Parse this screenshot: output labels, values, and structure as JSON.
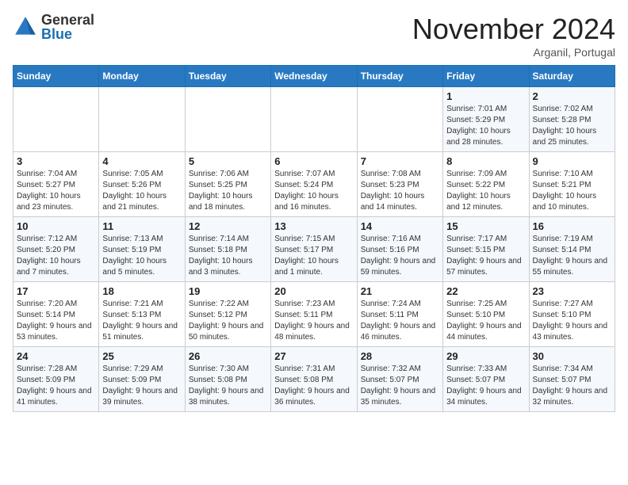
{
  "logo": {
    "general": "General",
    "blue": "Blue"
  },
  "header": {
    "month": "November 2024",
    "location": "Arganil, Portugal"
  },
  "weekdays": [
    "Sunday",
    "Monday",
    "Tuesday",
    "Wednesday",
    "Thursday",
    "Friday",
    "Saturday"
  ],
  "weeks": [
    [
      {
        "day": "",
        "info": ""
      },
      {
        "day": "",
        "info": ""
      },
      {
        "day": "",
        "info": ""
      },
      {
        "day": "",
        "info": ""
      },
      {
        "day": "",
        "info": ""
      },
      {
        "day": "1",
        "info": "Sunrise: 7:01 AM\nSunset: 5:29 PM\nDaylight: 10 hours and 28 minutes."
      },
      {
        "day": "2",
        "info": "Sunrise: 7:02 AM\nSunset: 5:28 PM\nDaylight: 10 hours and 25 minutes."
      }
    ],
    [
      {
        "day": "3",
        "info": "Sunrise: 7:04 AM\nSunset: 5:27 PM\nDaylight: 10 hours and 23 minutes."
      },
      {
        "day": "4",
        "info": "Sunrise: 7:05 AM\nSunset: 5:26 PM\nDaylight: 10 hours and 21 minutes."
      },
      {
        "day": "5",
        "info": "Sunrise: 7:06 AM\nSunset: 5:25 PM\nDaylight: 10 hours and 18 minutes."
      },
      {
        "day": "6",
        "info": "Sunrise: 7:07 AM\nSunset: 5:24 PM\nDaylight: 10 hours and 16 minutes."
      },
      {
        "day": "7",
        "info": "Sunrise: 7:08 AM\nSunset: 5:23 PM\nDaylight: 10 hours and 14 minutes."
      },
      {
        "day": "8",
        "info": "Sunrise: 7:09 AM\nSunset: 5:22 PM\nDaylight: 10 hours and 12 minutes."
      },
      {
        "day": "9",
        "info": "Sunrise: 7:10 AM\nSunset: 5:21 PM\nDaylight: 10 hours and 10 minutes."
      }
    ],
    [
      {
        "day": "10",
        "info": "Sunrise: 7:12 AM\nSunset: 5:20 PM\nDaylight: 10 hours and 7 minutes."
      },
      {
        "day": "11",
        "info": "Sunrise: 7:13 AM\nSunset: 5:19 PM\nDaylight: 10 hours and 5 minutes."
      },
      {
        "day": "12",
        "info": "Sunrise: 7:14 AM\nSunset: 5:18 PM\nDaylight: 10 hours and 3 minutes."
      },
      {
        "day": "13",
        "info": "Sunrise: 7:15 AM\nSunset: 5:17 PM\nDaylight: 10 hours and 1 minute."
      },
      {
        "day": "14",
        "info": "Sunrise: 7:16 AM\nSunset: 5:16 PM\nDaylight: 9 hours and 59 minutes."
      },
      {
        "day": "15",
        "info": "Sunrise: 7:17 AM\nSunset: 5:15 PM\nDaylight: 9 hours and 57 minutes."
      },
      {
        "day": "16",
        "info": "Sunrise: 7:19 AM\nSunset: 5:14 PM\nDaylight: 9 hours and 55 minutes."
      }
    ],
    [
      {
        "day": "17",
        "info": "Sunrise: 7:20 AM\nSunset: 5:14 PM\nDaylight: 9 hours and 53 minutes."
      },
      {
        "day": "18",
        "info": "Sunrise: 7:21 AM\nSunset: 5:13 PM\nDaylight: 9 hours and 51 minutes."
      },
      {
        "day": "19",
        "info": "Sunrise: 7:22 AM\nSunset: 5:12 PM\nDaylight: 9 hours and 50 minutes."
      },
      {
        "day": "20",
        "info": "Sunrise: 7:23 AM\nSunset: 5:11 PM\nDaylight: 9 hours and 48 minutes."
      },
      {
        "day": "21",
        "info": "Sunrise: 7:24 AM\nSunset: 5:11 PM\nDaylight: 9 hours and 46 minutes."
      },
      {
        "day": "22",
        "info": "Sunrise: 7:25 AM\nSunset: 5:10 PM\nDaylight: 9 hours and 44 minutes."
      },
      {
        "day": "23",
        "info": "Sunrise: 7:27 AM\nSunset: 5:10 PM\nDaylight: 9 hours and 43 minutes."
      }
    ],
    [
      {
        "day": "24",
        "info": "Sunrise: 7:28 AM\nSunset: 5:09 PM\nDaylight: 9 hours and 41 minutes."
      },
      {
        "day": "25",
        "info": "Sunrise: 7:29 AM\nSunset: 5:09 PM\nDaylight: 9 hours and 39 minutes."
      },
      {
        "day": "26",
        "info": "Sunrise: 7:30 AM\nSunset: 5:08 PM\nDaylight: 9 hours and 38 minutes."
      },
      {
        "day": "27",
        "info": "Sunrise: 7:31 AM\nSunset: 5:08 PM\nDaylight: 9 hours and 36 minutes."
      },
      {
        "day": "28",
        "info": "Sunrise: 7:32 AM\nSunset: 5:07 PM\nDaylight: 9 hours and 35 minutes."
      },
      {
        "day": "29",
        "info": "Sunrise: 7:33 AM\nSunset: 5:07 PM\nDaylight: 9 hours and 34 minutes."
      },
      {
        "day": "30",
        "info": "Sunrise: 7:34 AM\nSunset: 5:07 PM\nDaylight: 9 hours and 32 minutes."
      }
    ]
  ]
}
